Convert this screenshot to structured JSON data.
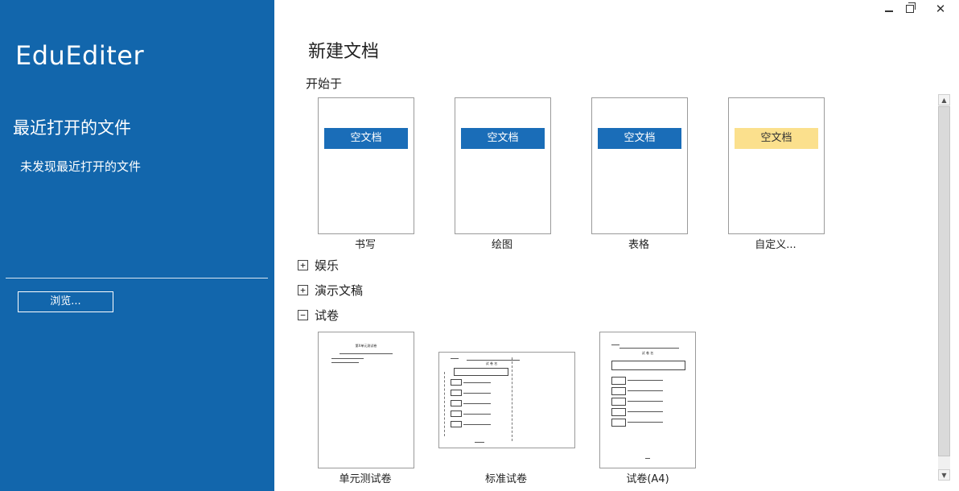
{
  "sidebar": {
    "app_title": "EduEditer",
    "recent_heading": "最近打开的文件",
    "recent_empty": "未发现最近打开的文件",
    "browse_label": "浏览..."
  },
  "window": {
    "minimize_icon": "minimize-icon",
    "restore_icon": "restore-icon",
    "close_icon": "close-icon",
    "close_glyph": "✕"
  },
  "main": {
    "title": "新建文档",
    "start_label": "开始于",
    "templates": [
      {
        "banner": "空文档",
        "caption": "书写"
      },
      {
        "banner": "空文档",
        "caption": "绘图"
      },
      {
        "banner": "空文档",
        "caption": "表格"
      },
      {
        "banner": "空文档",
        "caption": "自定义..."
      }
    ],
    "groups": [
      {
        "expander": "+",
        "label": "娱乐"
      },
      {
        "expander": "+",
        "label": "演示文稿"
      },
      {
        "expander": "−",
        "label": "试卷"
      }
    ],
    "exams": [
      {
        "caption": "单元测试卷",
        "doc_title": "第X单元测试卷"
      },
      {
        "caption": "标准试卷",
        "doc_title": "试 卷 名"
      },
      {
        "caption": "试卷(A4)",
        "doc_title": "试 卷 名"
      }
    ]
  },
  "colors": {
    "sidebar_bg": "#1266ac",
    "banner_blue": "#1a6db8",
    "banner_yellow": "#fbe08d"
  }
}
